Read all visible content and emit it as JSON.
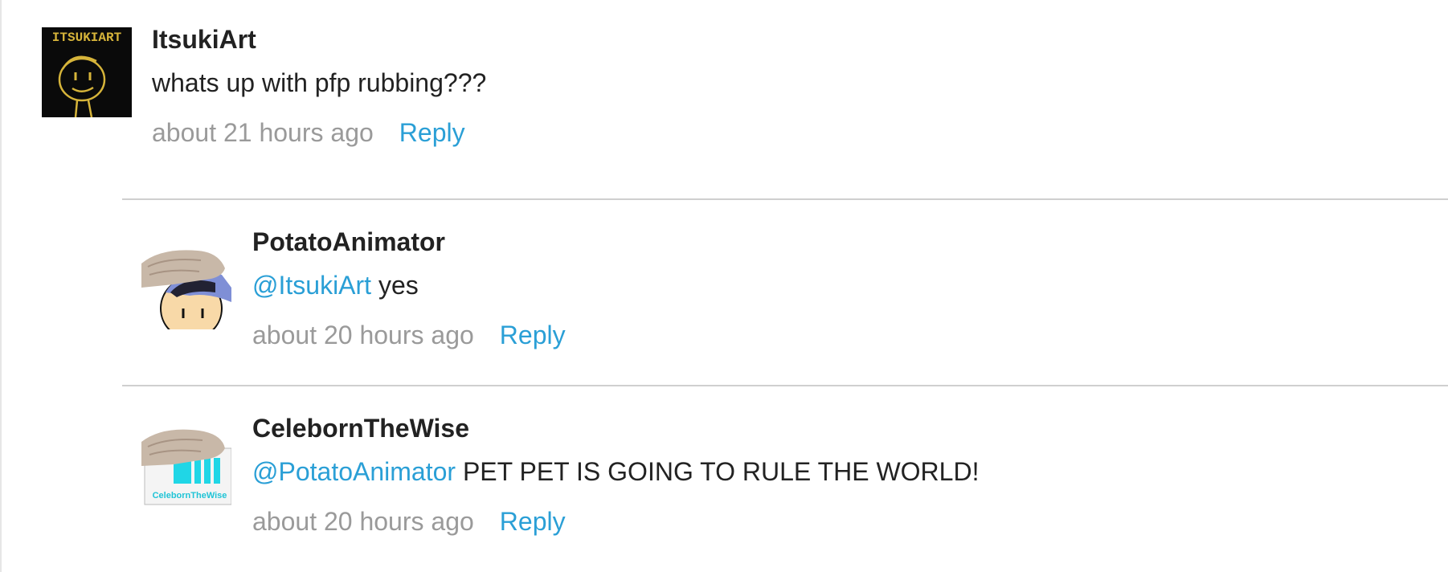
{
  "comments": [
    {
      "username": "ItsukiArt",
      "text": "whats up with pfp rubbing???",
      "time": "about 21 hours ago",
      "reply_label": "Reply",
      "avatar_text": "ITSUKIART"
    },
    {
      "username": "PotatoAnimator",
      "mention": "@ItsukiArt",
      "text": " yes",
      "time": "about 20 hours ago",
      "reply_label": "Reply"
    },
    {
      "username": "CelebornTheWise",
      "mention": "@PotatoAnimator",
      "text": " PET PET IS GOING TO RULE THE WORLD!",
      "time": "about 20 hours ago",
      "reply_label": "Reply",
      "avatar_text": "CelebornTheWise"
    }
  ],
  "colors": {
    "link": "#2a9fd6",
    "muted": "#9a9a9a",
    "text": "#222222",
    "divider": "#cfcfcf"
  },
  "icons": [
    "itsukiart-avatar",
    "petpet-hand-avatar",
    "petpet-hand-avatar"
  ]
}
